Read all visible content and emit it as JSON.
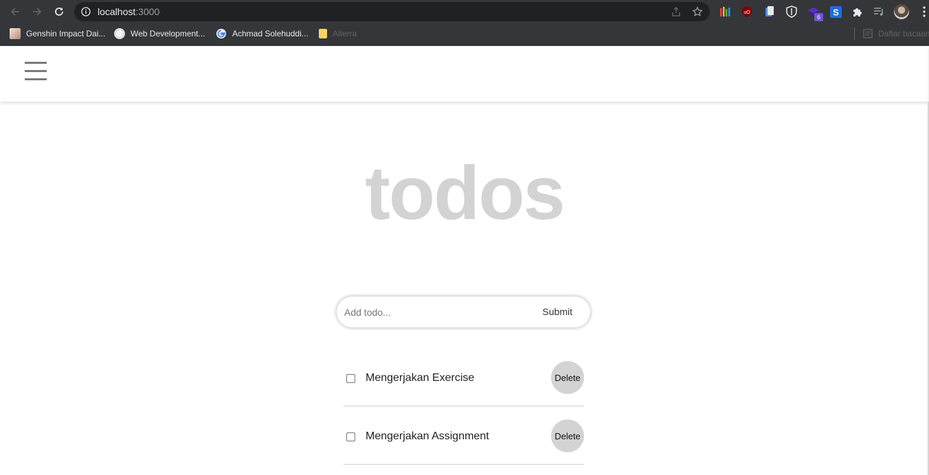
{
  "browser": {
    "url_host": "localhost",
    "url_port": ":3000",
    "extensions": [
      "bar-chart-extension-icon",
      "ublock-origin-icon",
      "clipboard-extension-icon",
      "shield-extension-icon",
      "mortarboard-extension-icon",
      "s-extension-icon",
      "puzzle-extensions-icon",
      "media-control-icon"
    ],
    "extension_badge": "6",
    "bookmarks": [
      {
        "label": "Genshin Impact Dai...",
        "icon": "genshin-favicon"
      },
      {
        "label": "Web Development...",
        "icon": "coin-favicon"
      },
      {
        "label": "Achmad Solehuddi...",
        "icon": "google-favicon"
      },
      {
        "label": "Alterra",
        "icon": "folder-favicon"
      }
    ],
    "reading_list_label": "Daftar bacaan"
  },
  "app": {
    "title": "todos",
    "input_placeholder": "Add todo...",
    "submit_label": "Submit",
    "todos": [
      {
        "text": "Mengerjakan Exercise",
        "delete_label": "Delete",
        "checked": false
      },
      {
        "text": "Mengerjakan Assignment",
        "delete_label": "Delete",
        "checked": false
      }
    ]
  },
  "colors": {
    "chrome_bg": "#35363a",
    "omnibox_bg": "#202124",
    "title": "#d3d3d3",
    "delete_bg": "#d3d3d3"
  }
}
